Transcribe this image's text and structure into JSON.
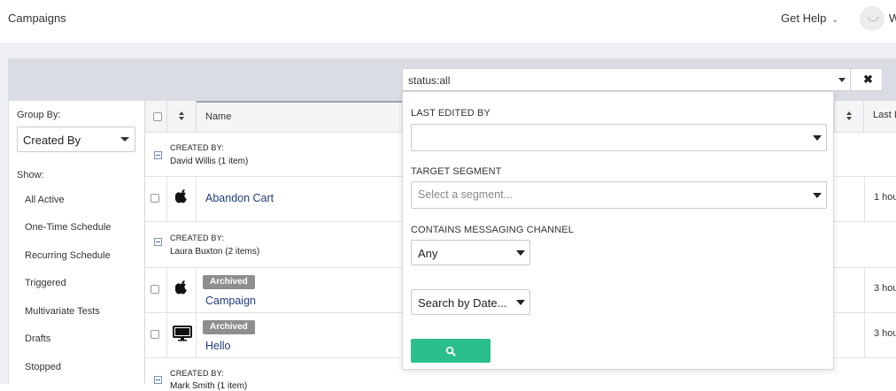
{
  "header": {
    "title": "Campaigns",
    "help_label": "Get Help",
    "user_initial": "W"
  },
  "search": {
    "value": "status:all"
  },
  "sidebar": {
    "group_by_label": "Group By:",
    "group_by_value": "Created By",
    "show_label": "Show:",
    "items": [
      "All Active",
      "One-Time Schedule",
      "Recurring Schedule",
      "Triggered",
      "Multivariate Tests",
      "Drafts",
      "Stopped"
    ]
  },
  "table": {
    "columns": {
      "name": "Name",
      "last": "Last I"
    },
    "groups": [
      {
        "label": "CREATED BY:",
        "owner": "David Willis (1 item)"
      },
      {
        "label": "CREATED BY:",
        "owner": "Laura Buxton (2 items)"
      },
      {
        "label": "CREATED BY:",
        "owner": "Mark Smith (1 item)"
      }
    ],
    "rows": [
      {
        "name": "Abandon Cart",
        "badge": "",
        "platform_icon": "apple-icon",
        "last": "1 hou"
      },
      {
        "name": "Campaign",
        "badge": "Archived",
        "platform_icon": "apple-icon",
        "last": "3 hou"
      },
      {
        "name": "Hello",
        "badge": "Archived",
        "platform_icon": "desktop-icon",
        "last": "3 hou"
      }
    ]
  },
  "filter": {
    "last_edited_label": "LAST EDITED BY",
    "last_edited_value": "",
    "segment_label": "TARGET SEGMENT",
    "segment_placeholder": "Select a segment...",
    "channel_label": "CONTAINS MESSAGING CHANNEL",
    "channel_value": "Any",
    "date_value": "Search by Date...",
    "accent_color": "#2bbf8b"
  }
}
